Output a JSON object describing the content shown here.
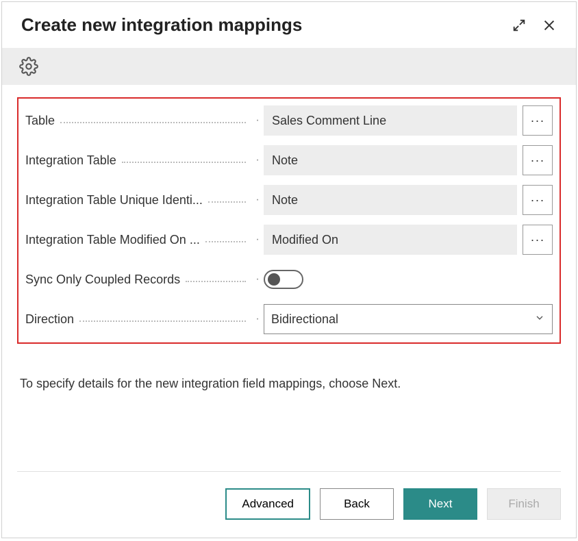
{
  "header": {
    "title": "Create new integration mappings"
  },
  "form": {
    "rows": [
      {
        "label": "Table",
        "value": "Sales Comment Line",
        "type": "lookup"
      },
      {
        "label": "Integration Table",
        "value": "Note",
        "type": "lookup"
      },
      {
        "label": "Integration Table Unique Identi...",
        "value": "Note",
        "type": "lookup"
      },
      {
        "label": "Integration Table Modified On ...",
        "value": "Modified On",
        "type": "lookup"
      },
      {
        "label": "Sync Only Coupled Records",
        "type": "toggle",
        "checked": false
      },
      {
        "label": "Direction",
        "value": "Bidirectional",
        "type": "select"
      }
    ]
  },
  "helpText": "To specify details for the new integration field mappings, choose Next.",
  "footer": {
    "advanced": "Advanced",
    "back": "Back",
    "next": "Next",
    "finish": "Finish"
  },
  "icons": {
    "ellipsis": "···"
  }
}
